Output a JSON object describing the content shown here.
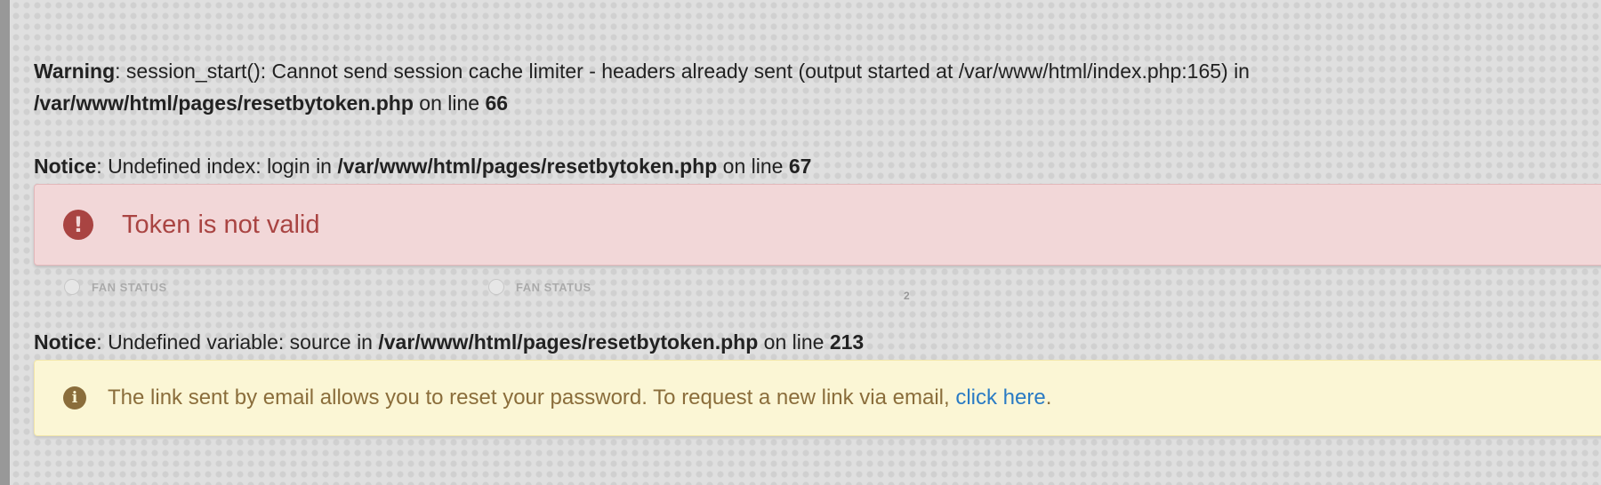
{
  "warning1": {
    "label": "Warning",
    "text_a": ": session_start(): Cannot send session cache limiter - headers already sent (output started at /var/www/html/index.php:165) in",
    "path": "/var/www/html/pages/resetbytoken.php",
    "on_line": " on line ",
    "line": "66"
  },
  "notice1": {
    "label": "Notice",
    "text": ": Undefined index: login in ",
    "path": "/var/www/html/pages/resetbytoken.php",
    "on_line": " on line ",
    "line": "67"
  },
  "danger_alert": {
    "icon": "exclamation-circle-icon",
    "icon_glyph": "!",
    "message": "Token is not valid"
  },
  "background": {
    "label_1": "FAN STATUS",
    "label_2": "FAN STATUS",
    "label_3": "2"
  },
  "notice2": {
    "label": "Notice",
    "text": ": Undefined variable: source in ",
    "path": "/var/www/html/pages/resetbytoken.php",
    "on_line": " on line ",
    "line": "213"
  },
  "info_alert": {
    "icon": "info-circle-icon",
    "icon_glyph": "i",
    "message": "The link sent by email allows you to reset your password. To request a new link via email, ",
    "link_text": "click here",
    "suffix": "."
  }
}
